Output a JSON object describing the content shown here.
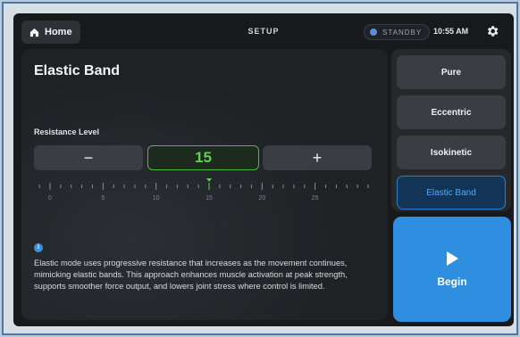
{
  "topbar": {
    "home_label": "Home",
    "title": "SETUP",
    "status": "STANDBY",
    "status_color": "#5a8fd8",
    "time": "10:55 AM",
    "settings_icon": "gear-icon"
  },
  "panel": {
    "title": "Elastic Band",
    "resistance_label": "Resistance Level",
    "minus_label": "−",
    "plus_label": "+",
    "value": "15",
    "value_color": "#5fd04f",
    "ruler_ticks": [
      "0",
      "5",
      "10",
      "15",
      "20",
      "25"
    ],
    "selected_tick": "15",
    "info_icon": "info-icon",
    "description": "Elastic mode uses progressive resistance that increases as the movement continues, mimicking elastic bands. This approach enhances muscle activation at peak strength, supports smoother force output, and lowers joint stress where control is limited."
  },
  "modes": [
    {
      "label": "Pure",
      "active": false
    },
    {
      "label": "Eccentric",
      "active": false
    },
    {
      "label": "Isokinetic",
      "active": false
    },
    {
      "label": "Elastic Band",
      "active": true
    }
  ],
  "begin": {
    "label": "Begin",
    "icon": "play-icon",
    "color": "#2f8ee0"
  }
}
